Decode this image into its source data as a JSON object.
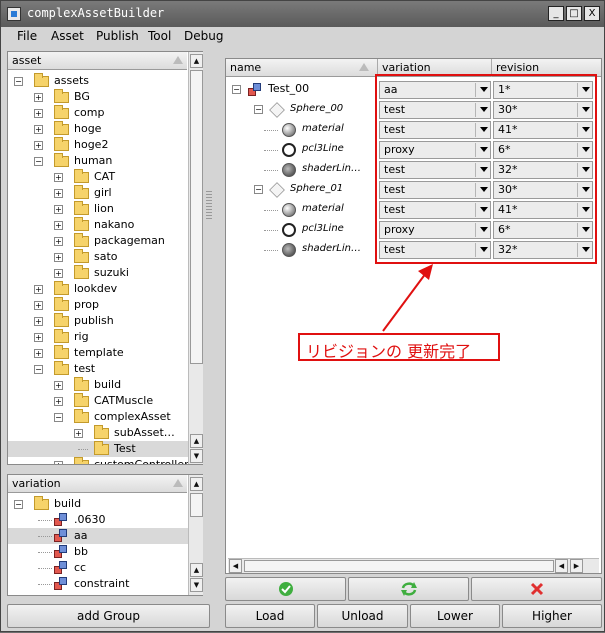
{
  "window": {
    "title": "complexAssetBuilder",
    "controls": [
      "_",
      "□",
      "X"
    ]
  },
  "menu": [
    "File",
    "Asset",
    "Publish",
    "Tool",
    "Debug"
  ],
  "asset_panel": {
    "header": "asset",
    "items": [
      {
        "label": "assets",
        "depth": 0,
        "expander": "−"
      },
      {
        "label": "BG",
        "depth": 1,
        "expander": "+"
      },
      {
        "label": "comp",
        "depth": 1,
        "expander": "+"
      },
      {
        "label": "hoge",
        "depth": 1,
        "expander": "+"
      },
      {
        "label": "hoge2",
        "depth": 1,
        "expander": "+"
      },
      {
        "label": "human",
        "depth": 1,
        "expander": "−"
      },
      {
        "label": "CAT",
        "depth": 2,
        "expander": "+"
      },
      {
        "label": "girl",
        "depth": 2,
        "expander": "+"
      },
      {
        "label": "lion",
        "depth": 2,
        "expander": "+"
      },
      {
        "label": "nakano",
        "depth": 2,
        "expander": "+"
      },
      {
        "label": "packageman",
        "depth": 2,
        "expander": "+"
      },
      {
        "label": "sato",
        "depth": 2,
        "expander": "+"
      },
      {
        "label": "suzuki",
        "depth": 2,
        "expander": "+"
      },
      {
        "label": "lookdev",
        "depth": 1,
        "expander": "+"
      },
      {
        "label": "prop",
        "depth": 1,
        "expander": "+"
      },
      {
        "label": "publish",
        "depth": 1,
        "expander": "+"
      },
      {
        "label": "rig",
        "depth": 1,
        "expander": "+"
      },
      {
        "label": "template",
        "depth": 1,
        "expander": "+"
      },
      {
        "label": "test",
        "depth": 1,
        "expander": "−"
      },
      {
        "label": "build",
        "depth": 2,
        "expander": "+"
      },
      {
        "label": "CATMuscle",
        "depth": 2,
        "expander": "+"
      },
      {
        "label": "complexAsset",
        "depth": 2,
        "expander": "−"
      },
      {
        "label": "subAsset…",
        "depth": 3,
        "expander": "+"
      },
      {
        "label": "Test",
        "depth": 3,
        "expander": "",
        "selected": true
      },
      {
        "label": "customController",
        "depth": 2,
        "expander": "+"
      }
    ]
  },
  "variation_panel": {
    "header": "variation",
    "items": [
      {
        "label": "build",
        "folder": true
      },
      {
        "label": ".0630",
        "folder": false
      },
      {
        "label": "aa",
        "folder": false,
        "selected": true
      },
      {
        "label": "bb",
        "folder": false
      },
      {
        "label": "cc",
        "folder": false
      },
      {
        "label": "constraint",
        "folder": false
      }
    ]
  },
  "add_group_label": "add Group",
  "main_table": {
    "columns": [
      "name",
      "variation",
      "revision"
    ],
    "rows": [
      {
        "name": "Test_00",
        "depth": 0,
        "icon": "asset-icon",
        "italic": false,
        "variation": "aa",
        "revision": "1*"
      },
      {
        "name": "Sphere_00",
        "depth": 1,
        "icon": "group-icon",
        "italic": true,
        "variation": "test",
        "revision": "30*"
      },
      {
        "name": "material",
        "depth": 2,
        "icon": "material-icon",
        "italic": true,
        "variation": "test",
        "revision": "41*"
      },
      {
        "name": "pcl3Line",
        "depth": 2,
        "icon": "curve-icon",
        "italic": true,
        "variation": "proxy",
        "revision": "6*"
      },
      {
        "name": "shaderLin…",
        "depth": 2,
        "icon": "shader-icon",
        "italic": true,
        "variation": "test",
        "revision": "32*"
      },
      {
        "name": "Sphere_01",
        "depth": 1,
        "icon": "group-icon",
        "italic": true,
        "variation": "test",
        "revision": "30*"
      },
      {
        "name": "material",
        "depth": 2,
        "icon": "material-icon",
        "italic": true,
        "variation": "test",
        "revision": "41*"
      },
      {
        "name": "pcl3Line",
        "depth": 2,
        "icon": "curve-icon",
        "italic": true,
        "variation": "proxy",
        "revision": "6*"
      },
      {
        "name": "shaderLin…",
        "depth": 2,
        "icon": "shader-icon",
        "italic": true,
        "variation": "test",
        "revision": "32*"
      }
    ]
  },
  "annotation": {
    "text": "リビジョンの 更新完了",
    "color": "#e01010"
  },
  "actions": {
    "ok_icon": "check-icon",
    "refresh_icon": "refresh-icon",
    "cancel_icon": "x-icon",
    "load": "Load",
    "unload": "Unload",
    "lower": "Lower",
    "higher": "Higher"
  },
  "colors": {
    "titlebar": "#5f5f5f",
    "selection": "#d9d9d9",
    "annotation_red": "#e01010",
    "check_green": "#3fae3f",
    "x_red": "#e03030"
  }
}
